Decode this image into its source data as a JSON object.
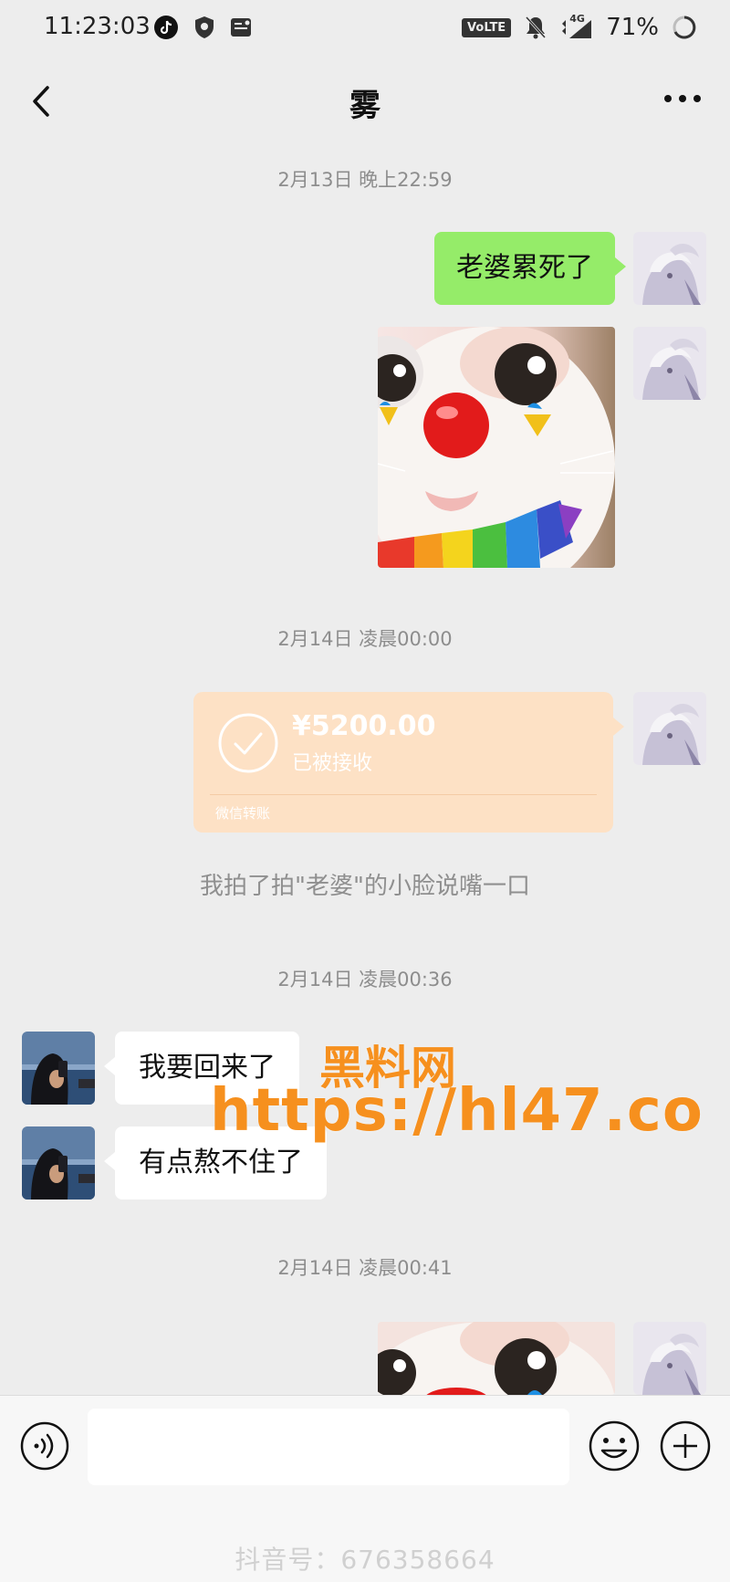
{
  "status_bar": {
    "time": "11:23:03",
    "network_badge": "VoLTE",
    "signal_type": "4G",
    "battery": "71%"
  },
  "header": {
    "title": "雾",
    "back_icon": "chevron-left-icon",
    "more_icon": "more-dots-icon"
  },
  "messages": {
    "ts1": "2月13日 晚上22:59",
    "msg1": "老婆累死了",
    "ts2": "2月14日 凌晨00:00",
    "transfer": {
      "amount": "¥5200.00",
      "status": "已被接收",
      "footer": "微信转账"
    },
    "system_note": "我拍了拍\"老婆\"的小脸说嘴一口",
    "ts3": "2月14日 凌晨00:36",
    "in1": "我要回来了",
    "in2": "有点熬不住了",
    "ts4": "2月14日 凌晨00:41"
  },
  "watermark": {
    "line1": "黑料网",
    "line2": "https://hl47.co"
  },
  "input_bar": {
    "placeholder": "",
    "voice_icon": "voice-icon",
    "emoji_icon": "emoji-icon",
    "plus_icon": "plus-icon"
  },
  "footer_watermark": "抖音号：676358664"
}
